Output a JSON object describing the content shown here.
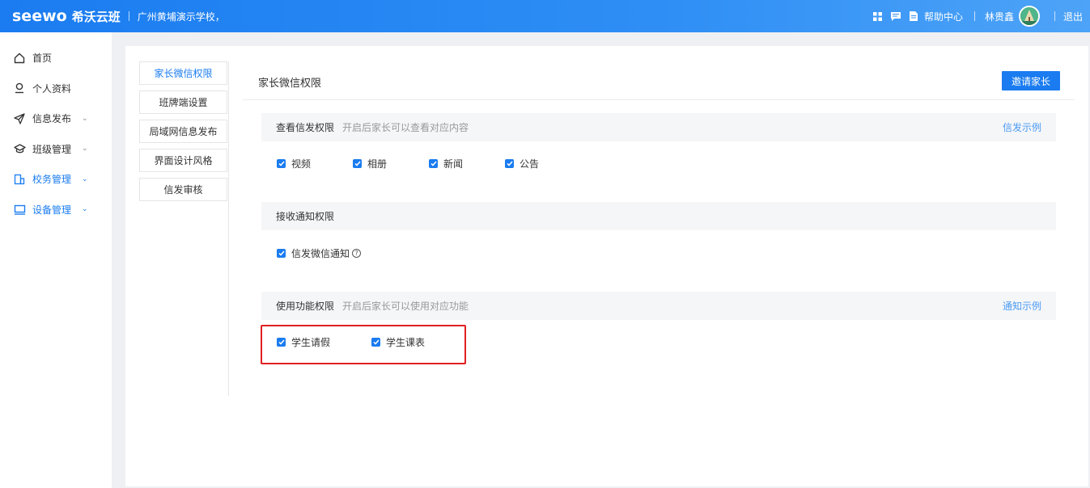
{
  "header": {
    "brand_en": "seewo",
    "brand_cn": "希沃云班",
    "school": "广州黄埔演示学校，",
    "help_label": "帮助中心",
    "user_name": "林贵鑫",
    "logout_label": "退出"
  },
  "sidebar": {
    "items": [
      {
        "label": "首页",
        "icon": "home-icon"
      },
      {
        "label": "个人资料",
        "icon": "user-icon"
      },
      {
        "label": "信息发布",
        "icon": "send-icon"
      },
      {
        "label": "班级管理",
        "icon": "graduation-cap-icon"
      },
      {
        "label": "校务管理",
        "icon": "school-affairs-icon"
      },
      {
        "label": "设备管理",
        "icon": "monitor-icon"
      }
    ]
  },
  "subnav": {
    "items": [
      {
        "label": "家长微信权限"
      },
      {
        "label": "班牌端设置"
      },
      {
        "label": "局域网信息发布"
      },
      {
        "label": "界面设计风格"
      },
      {
        "label": "信发审核"
      }
    ]
  },
  "content": {
    "title": "家长微信权限",
    "invite_label": "邀请家长",
    "sections": [
      {
        "title": "查看信发权限",
        "desc": "开启后家长可以查看对应内容",
        "link": "信发示例",
        "options": [
          {
            "label": "视频",
            "checked": true
          },
          {
            "label": "相册",
            "checked": true
          },
          {
            "label": "新闻",
            "checked": true
          },
          {
            "label": "公告",
            "checked": true
          }
        ]
      },
      {
        "title": "接收通知权限",
        "options": [
          {
            "label": "信发微信通知",
            "checked": true
          }
        ]
      },
      {
        "title": "使用功能权限",
        "desc": "开启后家长可以使用对应功能",
        "link": "通知示例",
        "options": [
          {
            "label": "学生请假",
            "checked": true
          },
          {
            "label": "学生课表",
            "checked": true
          }
        ]
      }
    ]
  },
  "colors": {
    "primary": "#1a7cf0",
    "link": "#4a9af4",
    "highlight": "#e02020"
  }
}
